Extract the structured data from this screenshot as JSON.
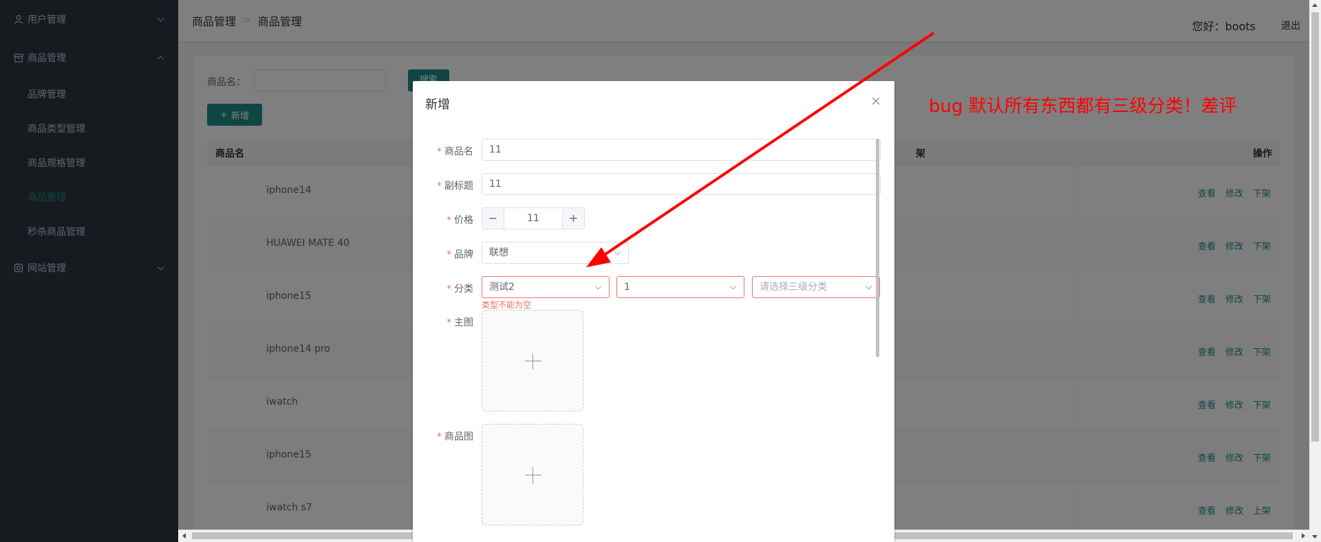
{
  "sidebar": {
    "items": [
      {
        "label": "用户管理",
        "icon": "user-icon"
      },
      {
        "label": "商品管理",
        "icon": "box-icon"
      },
      {
        "label": "网站管理",
        "icon": "globe-icon"
      }
    ],
    "sub_items": [
      {
        "label": "品牌管理"
      },
      {
        "label": "商品类型管理"
      },
      {
        "label": "商品规格管理"
      },
      {
        "label": "商品管理"
      },
      {
        "label": "秒杀商品管理"
      }
    ]
  },
  "header": {
    "breadcrumb": [
      "商品管理",
      "商品管理"
    ],
    "greeting": "您好：boots",
    "logout": "退出"
  },
  "search": {
    "label": "商品名：",
    "button": "搜索",
    "add_button": "新增"
  },
  "table": {
    "columns": [
      "商品名",
      "架",
      "操作"
    ],
    "rows": [
      {
        "name": "iphone14",
        "ops": [
          "查看",
          "修改",
          "下架"
        ]
      },
      {
        "name": "HUAWEI MATE 40",
        "ops": [
          "查看",
          "修改",
          "下架"
        ]
      },
      {
        "name": "iphone15",
        "ops": [
          "查看",
          "修改",
          "下架"
        ]
      },
      {
        "name": "iphone14 pro",
        "ops": [
          "查看",
          "修改",
          "下架"
        ]
      },
      {
        "name": "iwatch",
        "ops": [
          "查看",
          "修改",
          "下架"
        ]
      },
      {
        "name": "iphone15",
        "ops": [
          "查看",
          "修改",
          "下架"
        ]
      },
      {
        "name": "iwatch s7",
        "ops": [
          "查看",
          "修改",
          "上架"
        ]
      }
    ]
  },
  "dialog": {
    "title": "新增",
    "fields": {
      "name_label": "商品名",
      "name_value": "11",
      "subtitle_label": "副标题",
      "subtitle_value": "11",
      "price_label": "价格",
      "price_value": "11",
      "brand_label": "品牌",
      "brand_value": "联想",
      "category_label": "分类",
      "category1_value": "测试2",
      "category2_value": "1",
      "category3_placeholder": "请选择三级分类",
      "category_error": "类型不能为空",
      "main_image_label": "主图",
      "product_image_label": "商品图"
    }
  },
  "annotation": {
    "text": "bug  默认所有东西都有三级分类！差评",
    "color": "#ff0000"
  },
  "colors": {
    "accent": "#1e8c87",
    "sidebar_bg": "#2e3640",
    "error": "#f56c6c"
  }
}
